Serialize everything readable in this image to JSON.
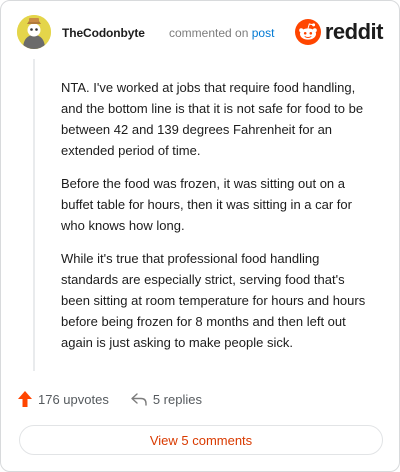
{
  "comment": {
    "author": "TheCodonbyte",
    "action_text": "commented on",
    "target_link": "post",
    "paragraphs": [
      "NTA. I've worked at jobs that require food handling, and the bottom line is that it is not safe for food to be between 42 and 139 degrees Fahrenheit for an extended period of time.",
      "Before the food was frozen, it was sitting out on a buffet table for hours, then it was sitting in a car for who knows how long.",
      "While it's true that professional food handling standards are especially strict, serving food that's been sitting at room temperature for hours and hours before being frozen for 8 months and then left out again is just asking to make people sick."
    ]
  },
  "brand": {
    "name": "reddit",
    "icon": "reddit-logo-icon",
    "color": "#ff4500"
  },
  "footer": {
    "upvotes": "176 upvotes",
    "replies": "5 replies",
    "view_comments": "View 5 comments"
  },
  "colors": {
    "accent": "#d93a00",
    "link": "#0079d3",
    "upvote": "#ff4500"
  }
}
